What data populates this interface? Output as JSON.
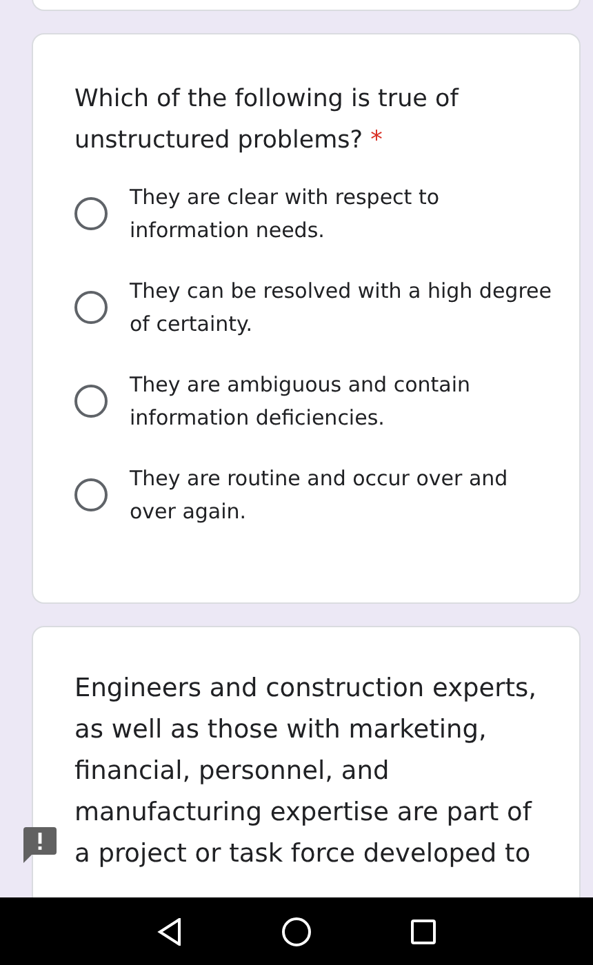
{
  "question": {
    "title": "Which of the following is true of unstructured problems?",
    "required_mark": "*",
    "options": [
      {
        "label": "They are clear with respect to information needs.",
        "selected": false
      },
      {
        "label": "They can be resolved with a high degree of certainty.",
        "selected": false
      },
      {
        "label": "They are ambiguous and contain information deficiencies.",
        "selected": false
      },
      {
        "label": "They are routine and occur over and over again.",
        "selected": false
      }
    ]
  },
  "next_question": {
    "text": "Engineers and construction experts, as well as those with marketing, financial, personnel, and manufacturing expertise are part of a project or task force developed to"
  }
}
